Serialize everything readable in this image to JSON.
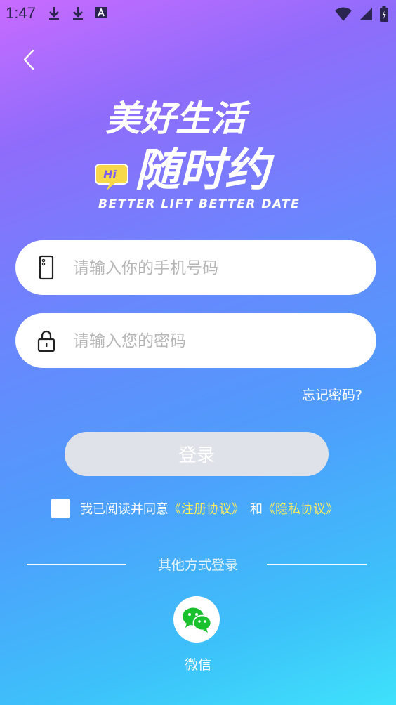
{
  "status_bar": {
    "time": "1:47"
  },
  "logo": {
    "line1": "美好生活",
    "line2": "随时约",
    "badge": "Hi",
    "tagline": "BETTER LIFT BETTER DATE"
  },
  "form": {
    "phone_placeholder": "请输入你的手机号码",
    "password_placeholder": "请输入您的密码",
    "forgot_label": "忘记密码?",
    "login_label": "登录"
  },
  "agreement": {
    "prefix": "我已阅读并同意",
    "terms_link": "《注册协议》",
    "and": "和",
    "privacy_link": "《隐私协议》"
  },
  "other_login": {
    "title": "其他方式登录",
    "wechat_label": "微信"
  },
  "colors": {
    "link_yellow": "#f8ec5f",
    "button_disabled": "#dfe2e8",
    "wechat_green": "#19c22c"
  }
}
